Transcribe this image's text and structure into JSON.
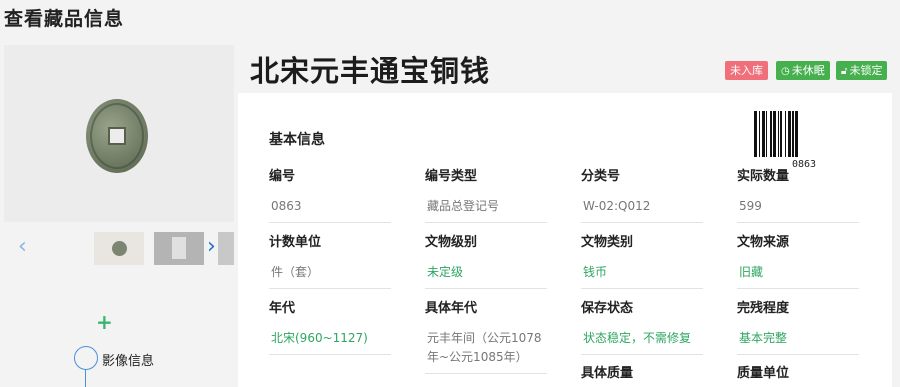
{
  "page": {
    "title": "查看藏品信息"
  },
  "item": {
    "title": "北宋元丰通宝铜钱"
  },
  "badges": {
    "storage": "未入库",
    "dormant": "未休眠",
    "lock": "未锁定"
  },
  "colors": {
    "badge_red": "#ef6f7a",
    "badge_green": "#46b04f",
    "value_green": "#2fa660"
  },
  "gallery": {
    "image_info_label": "影像信息"
  },
  "info": {
    "section_title": "基本信息",
    "barcode_number": "0863",
    "fields": [
      {
        "label": "编号",
        "value": "0863"
      },
      {
        "label": "编号类型",
        "value": "藏品总登记号"
      },
      {
        "label": "分类号",
        "value": "W-02:Q012"
      },
      {
        "label": "实际数量",
        "value": "599"
      },
      {
        "label": "计数单位",
        "value": "件（套）"
      },
      {
        "label": "文物级别",
        "value": "未定级"
      },
      {
        "label": "文物类别",
        "value": "钱币"
      },
      {
        "label": "文物来源",
        "value": "旧藏"
      },
      {
        "label": "年代",
        "value": "北宋(960~1127)"
      },
      {
        "label": "具体年代",
        "value": "元丰年间（公元1078年~公元1085年）"
      },
      {
        "label": "保存状态",
        "value": "状态稳定，不需修复"
      },
      {
        "label": "完残程度",
        "value": "基本完整"
      },
      {
        "label": "具体质量",
        "value": ""
      },
      {
        "label": "质量单位",
        "value": ""
      }
    ]
  }
}
